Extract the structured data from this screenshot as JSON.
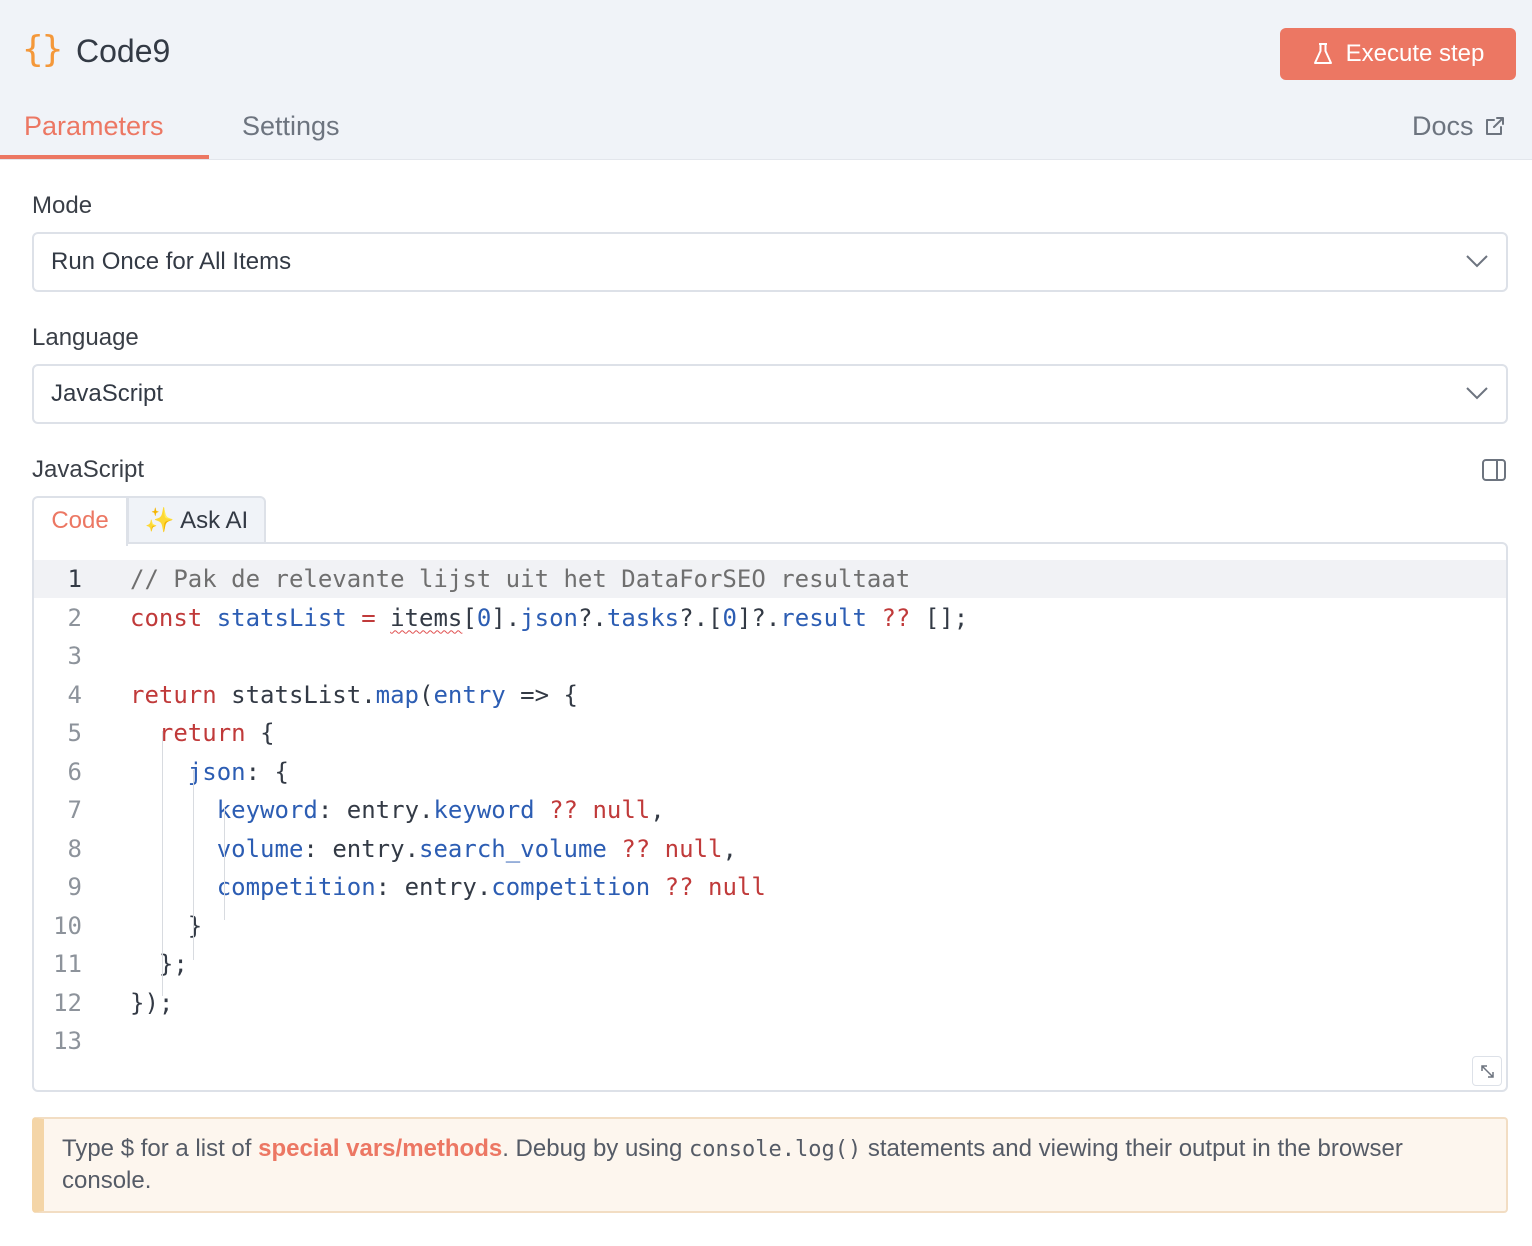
{
  "header": {
    "node_icon": "{}",
    "node_icon_name": "braces-icon",
    "title": "Code9",
    "execute_label": "Execute step",
    "tabs": [
      {
        "label": "Parameters",
        "active": true
      },
      {
        "label": "Settings",
        "active": false
      }
    ],
    "docs_label": "Docs"
  },
  "params": {
    "mode": {
      "label": "Mode",
      "value": "Run Once for All Items"
    },
    "language": {
      "label": "Language",
      "value": "JavaScript"
    },
    "editor_label": "JavaScript",
    "editor_tabs": {
      "code": "Code",
      "ask_ai": "Ask AI",
      "ask_ai_icon": "✨"
    }
  },
  "code_lines": [
    "// Pak de relevante lijst uit het DataForSEO resultaat",
    "const statsList = items[0].json?.tasks?.[0]?.result ?? [];",
    "",
    "return statsList.map(entry => {",
    "  return {",
    "    json: {",
    "      keyword: entry.keyword ?? null,",
    "      volume: entry.search_volume ?? null,",
    "      competition: entry.competition ?? null",
    "    }",
    "  };",
    "});",
    ""
  ],
  "line_numbers": [
    "1",
    "2",
    "3",
    "4",
    "5",
    "6",
    "7",
    "8",
    "9",
    "10",
    "11",
    "12",
    "13"
  ],
  "notice": {
    "pre": "Type $ for a list of ",
    "link": "special vars/methods",
    "mid": ". Debug by using ",
    "code": "console.log()",
    "post": " statements and viewing their output in the browser console."
  },
  "colors": {
    "accent": "#ec7763",
    "keyword": "#c03a3a",
    "identifier": "#2c5db3",
    "icon": "#f4983a"
  }
}
